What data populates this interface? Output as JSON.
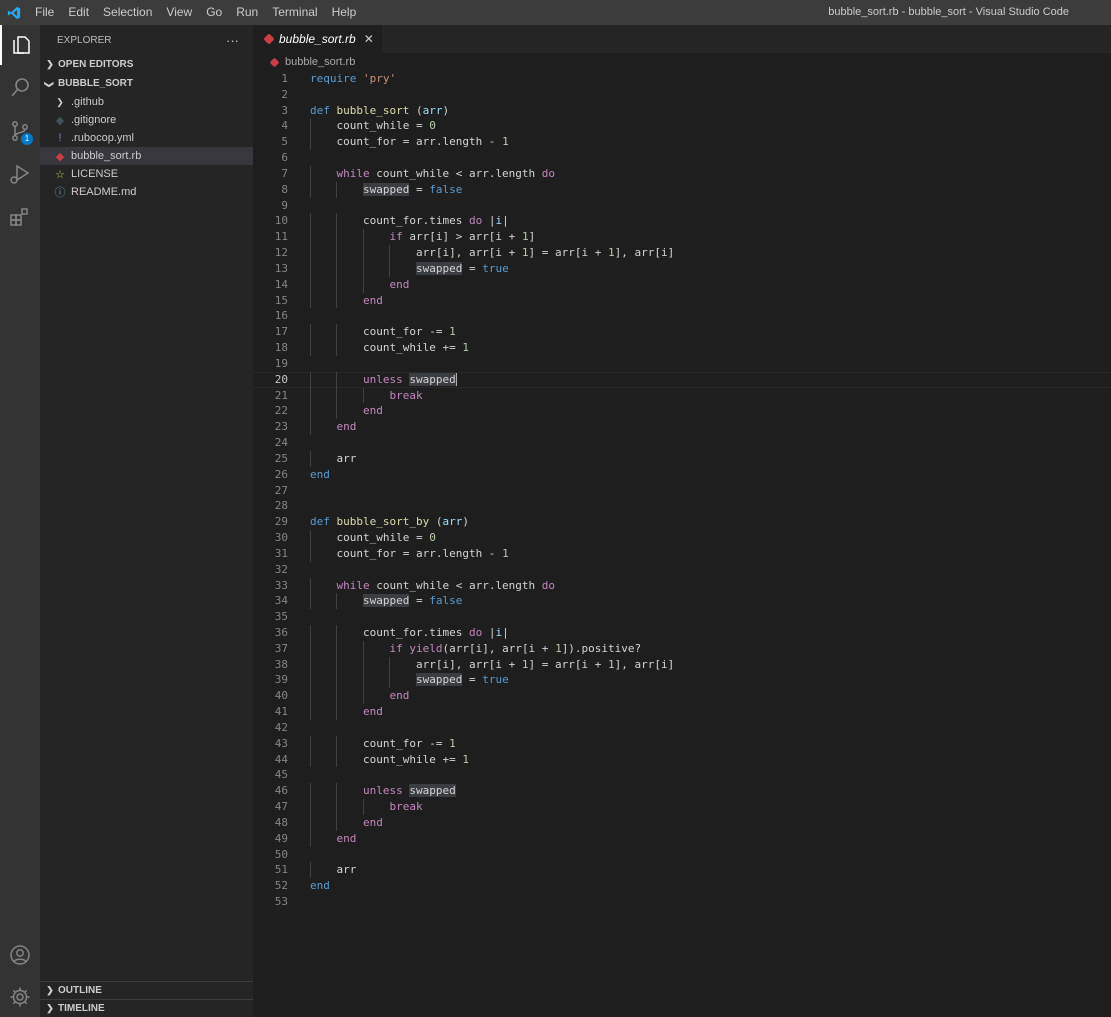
{
  "titlebar": {
    "menu": [
      "File",
      "Edit",
      "Selection",
      "View",
      "Go",
      "Run",
      "Terminal",
      "Help"
    ],
    "window_title": "bubble_sort.rb - bubble_sort - Visual Studio Code"
  },
  "activity_bar": {
    "items": [
      "files-icon",
      "search-icon",
      "source-control-icon",
      "run-debug-icon",
      "extensions-icon"
    ],
    "bottom": [
      "account-icon",
      "manage-gear-icon"
    ],
    "scm_badge": "1"
  },
  "sidebar": {
    "title": "EXPLORER",
    "more_actions": "···",
    "open_editors": "OPEN EDITORS",
    "folder": "BUBBLE_SORT",
    "files": [
      {
        "name": ".github",
        "icon": "chevron-right-icon",
        "color": "#cccccc"
      },
      {
        "name": ".gitignore",
        "icon": "git-file-icon",
        "color": "#41535b"
      },
      {
        "name": ".rubocop.yml",
        "icon": "yaml-icon",
        "color": "#a074c4"
      },
      {
        "name": "bubble_sort.rb",
        "icon": "ruby-icon",
        "color": "#cc3e44"
      },
      {
        "name": "LICENSE",
        "icon": "license-icon",
        "color": "#cbcb41"
      },
      {
        "name": "README.md",
        "icon": "info-icon",
        "color": "#519aba"
      }
    ],
    "outline": "OUTLINE",
    "timeline": "TIMELINE"
  },
  "editor": {
    "tab_label": "bubble_sort.rb",
    "tab_close": "✕",
    "breadcrumb": "bubble_sort.rb",
    "current_line": 20,
    "lines": [
      [
        [
          "def",
          "require "
        ],
        [
          "str",
          "'pry'"
        ]
      ],
      [],
      [
        [
          "def",
          "def "
        ],
        [
          "fn",
          "bubble_sort"
        ],
        [
          "pl",
          " ("
        ],
        [
          "var",
          "arr"
        ],
        [
          "pl",
          ")"
        ]
      ],
      [
        [
          "pl",
          "    count_while = "
        ],
        [
          "num",
          "0"
        ]
      ],
      [
        [
          "pl",
          "    count_for = arr.length - "
        ],
        [
          "num",
          "1"
        ]
      ],
      [],
      [
        [
          "kw",
          "    while"
        ],
        [
          "pl",
          " count_while < arr.length "
        ],
        [
          "kw",
          "do"
        ]
      ],
      [
        [
          "pl",
          "        "
        ],
        [
          "hl",
          "swapped"
        ],
        [
          "pl",
          " = "
        ],
        [
          "def",
          "false"
        ]
      ],
      [],
      [
        [
          "pl",
          "        count_for.times "
        ],
        [
          "kw",
          "do"
        ],
        [
          "pl",
          " |"
        ],
        [
          "var",
          "i"
        ],
        [
          "pl",
          "|"
        ]
      ],
      [
        [
          "kw",
          "            if"
        ],
        [
          "pl",
          " arr[i] > arr[i + "
        ],
        [
          "num",
          "1"
        ],
        [
          "pl",
          "]"
        ]
      ],
      [
        [
          "pl",
          "                arr[i], arr[i + "
        ],
        [
          "num",
          "1"
        ],
        [
          "pl",
          "] = arr[i + "
        ],
        [
          "num",
          "1"
        ],
        [
          "pl",
          "], arr[i]"
        ]
      ],
      [
        [
          "pl",
          "                "
        ],
        [
          "hl",
          "swapped"
        ],
        [
          "pl",
          " = "
        ],
        [
          "def",
          "true"
        ]
      ],
      [
        [
          "kw",
          "            end"
        ]
      ],
      [
        [
          "kw",
          "        end"
        ]
      ],
      [],
      [
        [
          "pl",
          "        count_for -= "
        ],
        [
          "num",
          "1"
        ]
      ],
      [
        [
          "pl",
          "        count_while += "
        ],
        [
          "num",
          "1"
        ]
      ],
      [],
      [
        [
          "kw",
          "        unless"
        ],
        [
          "pl",
          " "
        ],
        [
          "hl",
          "swapped"
        ]
      ],
      [
        [
          "kw",
          "            break"
        ]
      ],
      [
        [
          "kw",
          "        end"
        ]
      ],
      [
        [
          "kw",
          "    end"
        ]
      ],
      [],
      [
        [
          "pl",
          "    arr"
        ]
      ],
      [
        [
          "def",
          "end"
        ]
      ],
      [],
      [],
      [
        [
          "def",
          "def "
        ],
        [
          "fn",
          "bubble_sort_by"
        ],
        [
          "pl",
          " ("
        ],
        [
          "var",
          "arr"
        ],
        [
          "pl",
          ")"
        ]
      ],
      [
        [
          "pl",
          "    count_while = "
        ],
        [
          "num",
          "0"
        ]
      ],
      [
        [
          "pl",
          "    count_for = arr.length - "
        ],
        [
          "num",
          "1"
        ]
      ],
      [],
      [
        [
          "kw",
          "    while"
        ],
        [
          "pl",
          " count_while < arr.length "
        ],
        [
          "kw",
          "do"
        ]
      ],
      [
        [
          "pl",
          "        "
        ],
        [
          "hl",
          "swapped"
        ],
        [
          "pl",
          " = "
        ],
        [
          "def",
          "false"
        ]
      ],
      [],
      [
        [
          "pl",
          "        count_for.times "
        ],
        [
          "kw",
          "do"
        ],
        [
          "pl",
          " |"
        ],
        [
          "var",
          "i"
        ],
        [
          "pl",
          "|"
        ]
      ],
      [
        [
          "kw",
          "            if"
        ],
        [
          "pl",
          " "
        ],
        [
          "kw",
          "yield"
        ],
        [
          "pl",
          "(arr[i], arr[i + "
        ],
        [
          "num",
          "1"
        ],
        [
          "pl",
          "]).positive?"
        ]
      ],
      [
        [
          "pl",
          "                arr[i], arr[i + "
        ],
        [
          "num",
          "1"
        ],
        [
          "pl",
          "] = arr[i + "
        ],
        [
          "num",
          "1"
        ],
        [
          "pl",
          "], arr[i]"
        ]
      ],
      [
        [
          "pl",
          "                "
        ],
        [
          "hl",
          "swapped"
        ],
        [
          "pl",
          " = "
        ],
        [
          "def",
          "true"
        ]
      ],
      [
        [
          "kw",
          "            end"
        ]
      ],
      [
        [
          "kw",
          "        end"
        ]
      ],
      [],
      [
        [
          "pl",
          "        count_for -= "
        ],
        [
          "num",
          "1"
        ]
      ],
      [
        [
          "pl",
          "        count_while += "
        ],
        [
          "num",
          "1"
        ]
      ],
      [],
      [
        [
          "kw",
          "        unless"
        ],
        [
          "pl",
          " "
        ],
        [
          "hl",
          "swapped"
        ]
      ],
      [
        [
          "kw",
          "            break"
        ]
      ],
      [
        [
          "kw",
          "        end"
        ]
      ],
      [
        [
          "kw",
          "    end"
        ]
      ],
      [],
      [
        [
          "pl",
          "    arr"
        ]
      ],
      [
        [
          "def",
          "end"
        ]
      ],
      []
    ]
  }
}
